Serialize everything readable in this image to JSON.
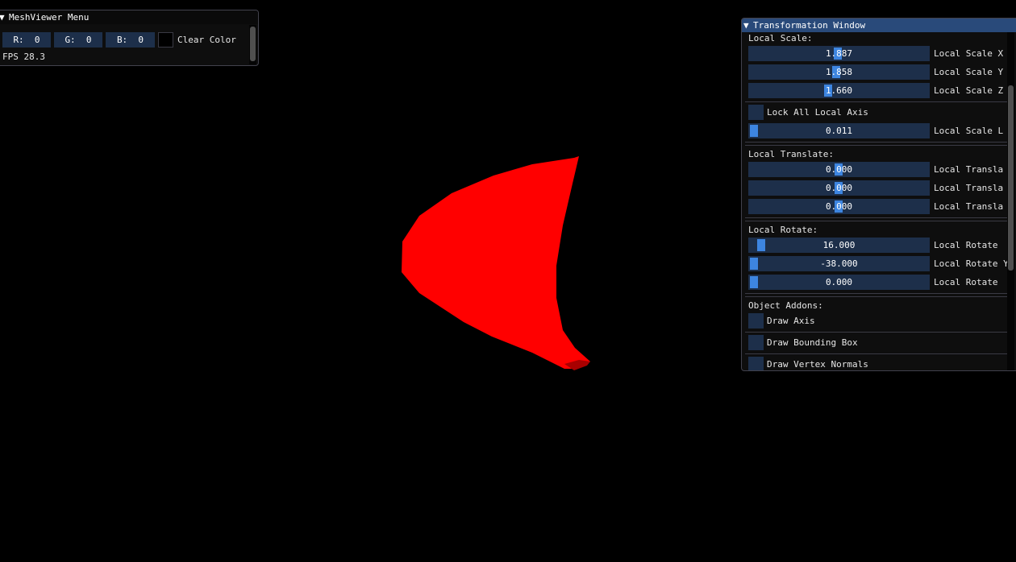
{
  "menu_window": {
    "title": "MeshViewer Menu",
    "color_r": "R:  0",
    "color_g": "G:  0",
    "color_b": "B:  0",
    "clear_color_label": "Clear Color",
    "fps_text": "FPS 28.3"
  },
  "transform_window": {
    "title": "Transformation Window",
    "local_scale_header": "Local Scale:",
    "scale_x": {
      "value": "1.887",
      "label": "Local Scale X"
    },
    "scale_y": {
      "value": "1.858",
      "label": "Local Scale Y"
    },
    "scale_z": {
      "value": "1.660",
      "label": "Local Scale Z"
    },
    "lock_axis_label": "Lock All Local Axis",
    "scale_l": {
      "value": "0.011",
      "label": "Local Scale L"
    },
    "local_translate_header": "Local Translate:",
    "translate_x": {
      "value": "0.000",
      "label": "Local Transla"
    },
    "translate_y": {
      "value": "0.000",
      "label": "Local Transla"
    },
    "translate_z": {
      "value": "0.000",
      "label": "Local Transla"
    },
    "local_rotate_header": "Local Rotate:",
    "rotate_x": {
      "value": "16.000",
      "label": "Local Rotate"
    },
    "rotate_y": {
      "value": "-38.000",
      "label": "Local Rotate Y"
    },
    "rotate_z": {
      "value": "0.000",
      "label": "Local Rotate"
    },
    "object_addons_header": "Object Addons:",
    "draw_axis_label": "Draw Axis",
    "draw_bbox_label": "Draw Bounding Box",
    "draw_normals_label": "Draw Vertex Normals"
  },
  "colors": {
    "background": "#000000",
    "mesh": "#ff0000",
    "title_active": "#294a7a",
    "frame": "#1d2f4a",
    "slider_grab": "#3d85e0"
  }
}
